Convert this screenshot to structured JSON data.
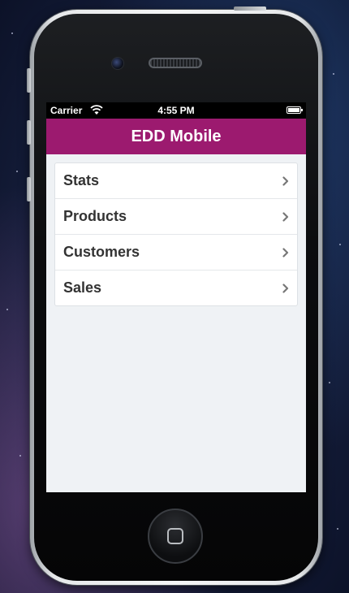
{
  "status_bar": {
    "carrier": "Carrier",
    "time": "4:55 PM",
    "wifi_icon": "wifi-icon",
    "battery_icon": "battery-icon"
  },
  "nav_bar": {
    "title": "EDD Mobile",
    "color": "#9c1a6f"
  },
  "menu": {
    "items": [
      {
        "label": "Stats",
        "icon": "chevron-right-icon"
      },
      {
        "label": "Products",
        "icon": "chevron-right-icon"
      },
      {
        "label": "Customers",
        "icon": "chevron-right-icon"
      },
      {
        "label": "Sales",
        "icon": "chevron-right-icon"
      }
    ]
  },
  "device": {
    "home_button_icon": "home-square-icon"
  }
}
